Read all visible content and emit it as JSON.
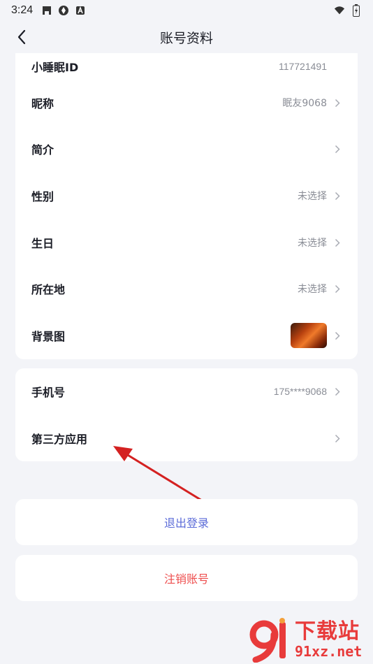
{
  "status_bar": {
    "time": "3:24",
    "icons_left": [
      "game-icon",
      "pinwheel-icon",
      "font-a-icon"
    ],
    "icons_right": [
      "wifi-icon",
      "battery-icon"
    ]
  },
  "nav": {
    "title": "账号资料",
    "back_icon": "chevron-left-icon"
  },
  "profile": {
    "partial_row": {
      "label": "小睡眠ID",
      "value": "117721491"
    },
    "rows": [
      {
        "label": "昵称",
        "value": "眠友9068"
      },
      {
        "label": "简介",
        "value": ""
      },
      {
        "label": "性别",
        "value": "未选择"
      },
      {
        "label": "生日",
        "value": "未选择"
      },
      {
        "label": "所在地",
        "value": "未选择"
      },
      {
        "label": "背景图",
        "value": ""
      }
    ]
  },
  "account": {
    "rows": [
      {
        "label": "手机号",
        "value": "175****9068"
      },
      {
        "label": "第三方应用",
        "value": ""
      }
    ]
  },
  "actions": {
    "logout_label": "退出登录",
    "cancel_account_label": "注销账号"
  },
  "watermark": {
    "title": "下载站",
    "url": "91xz.net"
  },
  "colors": {
    "background": "#f3f4f8",
    "card": "#ffffff",
    "logout": "#5b6bd8",
    "cancel": "#ee4d4d",
    "annotation": "#d42121"
  }
}
